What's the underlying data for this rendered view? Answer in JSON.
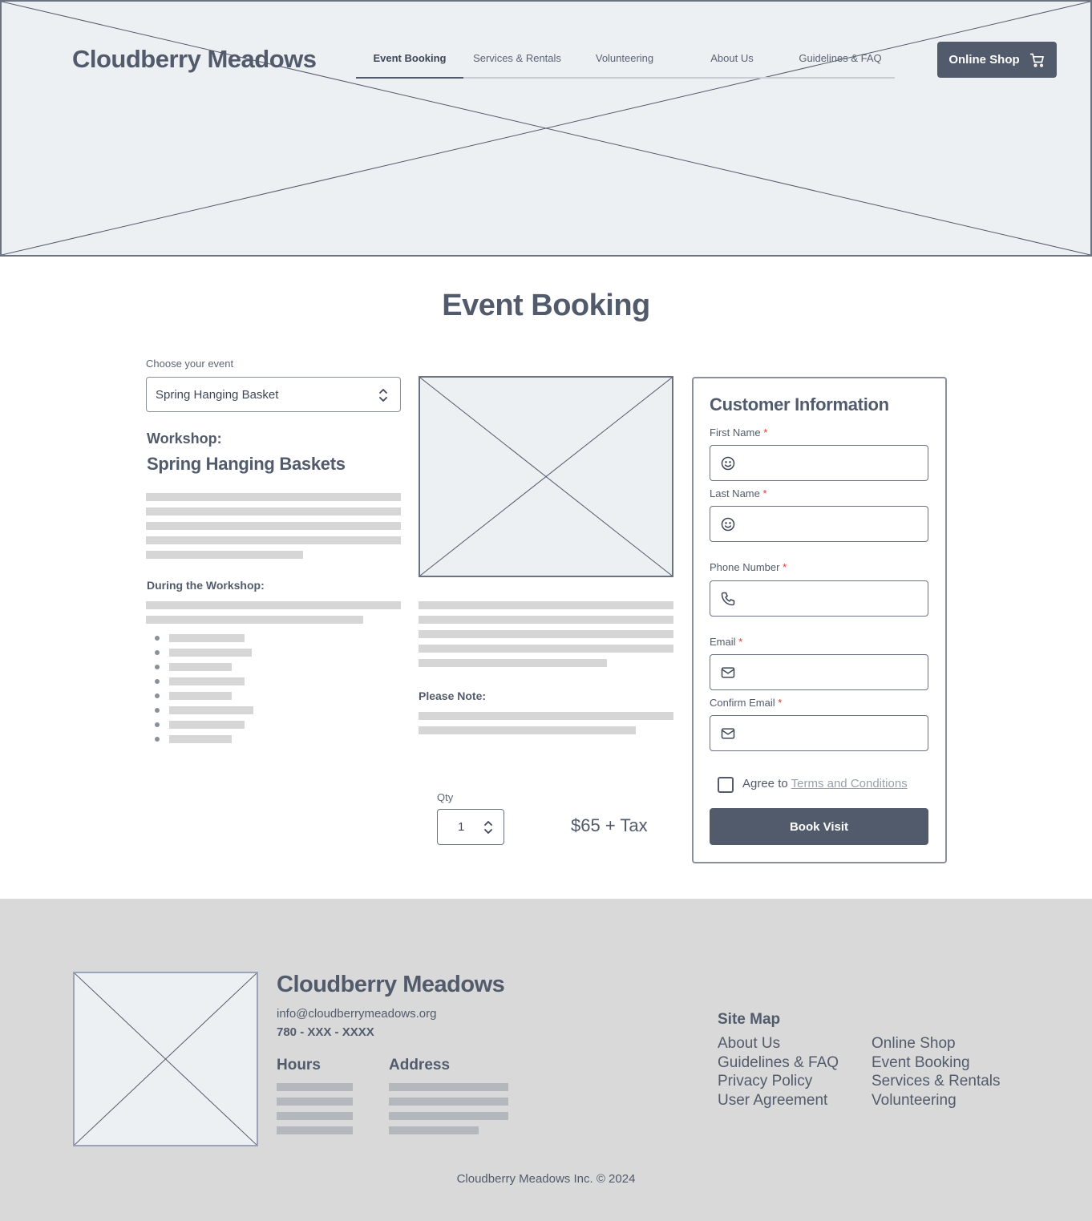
{
  "header": {
    "brand": "Cloudberry Meadows",
    "nav": [
      "Event Booking",
      "Services & Rentals",
      "Volunteering",
      "About Us",
      "Guidelines & FAQ"
    ],
    "active_nav": "Event Booking",
    "shop_button": "Online Shop"
  },
  "page_title": "Event Booking",
  "event_select": {
    "label": "Choose your event",
    "value": "Spring Hanging Basket"
  },
  "workshop": {
    "kicker": "Workshop:",
    "title": "Spring Hanging Baskets",
    "during_heading": "During the Workshop:"
  },
  "note_heading": "Please Note:",
  "order": {
    "qty_label": "Qty",
    "qty_value": "1",
    "price": "$65 + Tax"
  },
  "customer_form": {
    "title": "Customer Information",
    "required_marker": "*",
    "fields": [
      {
        "label": "First Name",
        "icon": "smiley-icon"
      },
      {
        "label": "Last Name",
        "icon": "smiley-icon"
      },
      {
        "label": "Phone Number",
        "icon": "phone-icon"
      },
      {
        "label": "Email",
        "icon": "mail-icon"
      },
      {
        "label": "Confirm Email",
        "icon": "mail-icon"
      }
    ],
    "agree_prefix": "Agree to",
    "terms_link": "Terms and Conditions",
    "submit": "Book Visit"
  },
  "footer": {
    "brand": "Cloudberry Meadows",
    "email": "info@cloudberrymeadows.org",
    "phone": "780 - XXX - XXXX",
    "hours_heading": "Hours",
    "address_heading": "Address",
    "sitemap_heading": "Site Map",
    "sitemap_col1": [
      "About Us",
      "Guidelines & FAQ",
      "Privacy Policy",
      "User Agreement"
    ],
    "sitemap_col2": [
      "Online Shop",
      "Event Booking",
      "Services & Rentals",
      "Volunteering"
    ],
    "copyright": "Cloudberry Meadows Inc. © 2024"
  },
  "colors": {
    "primary": "#525b6b",
    "placeholder_bg": "#edf0f3",
    "skeleton": "#d6d6d6",
    "footer_bg": "#d9d9d9",
    "required": "#e0392b"
  }
}
